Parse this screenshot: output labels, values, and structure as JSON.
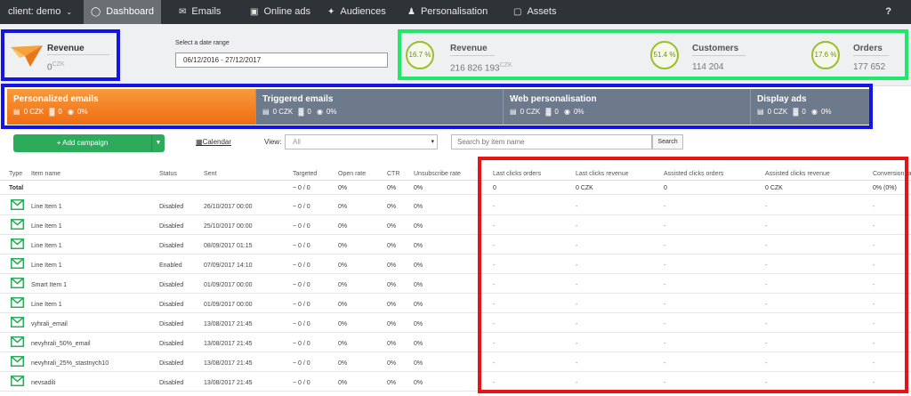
{
  "nav": {
    "client": "client: demo",
    "items": [
      {
        "label": "Dashboard",
        "icon": "dashboard-icon"
      },
      {
        "label": "Emails",
        "icon": "envelope-icon"
      },
      {
        "label": "Online ads",
        "icon": "image-icon"
      },
      {
        "label": "Audiences",
        "icon": "magic-wand-icon"
      },
      {
        "label": "Personalisation",
        "icon": "user-icon"
      },
      {
        "label": "Assets",
        "icon": "monitor-icon"
      }
    ],
    "help": "?"
  },
  "summary": {
    "left": {
      "label": "Revenue",
      "value": "0",
      "currency": "CZK"
    },
    "date_label": "Select a date range",
    "date_value": "06/12/2016 - 27/12/2017",
    "kpis": [
      {
        "percent": "16.7 %",
        "label": "Revenue",
        "value": "216 826 193",
        "currency": "CZK"
      },
      {
        "percent": "51.4 %",
        "label": "Customers",
        "value": "114 204",
        "currency": ""
      },
      {
        "percent": "17.6 %",
        "label": "Orders",
        "value": "177 652",
        "currency": ""
      }
    ]
  },
  "channels": [
    {
      "title": "Personalized emails",
      "revenue": "0 CZK",
      "orders": "0",
      "rate": "0%"
    },
    {
      "title": "Triggered emails",
      "revenue": "0 CZK",
      "orders": "0",
      "rate": "0%"
    },
    {
      "title": "Web personalisation",
      "revenue": "0 CZK",
      "orders": "0",
      "rate": "0%"
    },
    {
      "title": "Display ads",
      "revenue": "0 CZK",
      "orders": "0",
      "rate": "0%"
    }
  ],
  "toolbar": {
    "add_campaign": "+ Add campaign",
    "calendar": "Calendar",
    "view_label": "View:",
    "view_value": "All",
    "search_placeholder": "Search by item name",
    "search_button": "Search"
  },
  "table": {
    "headers": [
      "Type",
      "Item name",
      "Status",
      "Sent",
      "Targeted",
      "Open rate",
      "CTR",
      "Unsubscribe rate",
      "Last clicks orders",
      "Last clicks revenue",
      "Assisted clicks orders",
      "Assisted clicks revenue",
      "Conversion rate"
    ],
    "total": {
      "label": "Total",
      "targeted": "~ 0 / 0",
      "open_rate": "0%",
      "ctr": "0%",
      "unsub": "0%",
      "lc_orders": "0",
      "lc_revenue": "0 CZK",
      "ac_orders": "0",
      "ac_revenue": "0 CZK",
      "conversion": "0% (0%)"
    },
    "rows": [
      {
        "name": "Line Item 1",
        "status": "Disabled",
        "sent": "26/10/2017 00:00",
        "targeted": "~ 0 / 0",
        "open_rate": "0%",
        "ctr": "0%",
        "unsub": "0%"
      },
      {
        "name": "Line Item 1",
        "status": "Disabled",
        "sent": "25/10/2017 00:00",
        "targeted": "~ 0 / 0",
        "open_rate": "0%",
        "ctr": "0%",
        "unsub": "0%"
      },
      {
        "name": "Line Item 1",
        "status": "Disabled",
        "sent": "08/09/2017 01:15",
        "targeted": "~ 0 / 0",
        "open_rate": "0%",
        "ctr": "0%",
        "unsub": "0%"
      },
      {
        "name": "Line Item 1",
        "status": "Enabled",
        "sent": "07/09/2017 14:10",
        "targeted": "~ 0 / 0",
        "open_rate": "0%",
        "ctr": "0%",
        "unsub": "0%"
      },
      {
        "name": "Smart Item 1",
        "status": "Disabled",
        "sent": "01/09/2017 00:00",
        "targeted": "~ 0 / 0",
        "open_rate": "0%",
        "ctr": "0%",
        "unsub": "0%"
      },
      {
        "name": "Line Item 1",
        "status": "Disabled",
        "sent": "01/09/2017 00:00",
        "targeted": "~ 0 / 0",
        "open_rate": "0%",
        "ctr": "0%",
        "unsub": "0%"
      },
      {
        "name": "vyhrali_email",
        "status": "Disabled",
        "sent": "13/08/2017 21:45",
        "targeted": "~ 0 / 0",
        "open_rate": "0%",
        "ctr": "0%",
        "unsub": "0%"
      },
      {
        "name": "nevyhrali_50%_email",
        "status": "Disabled",
        "sent": "13/08/2017 21:45",
        "targeted": "~ 0 / 0",
        "open_rate": "0%",
        "ctr": "0%",
        "unsub": "0%"
      },
      {
        "name": "nevyhrali_25%_stastnych10",
        "status": "Disabled",
        "sent": "13/08/2017 21:45",
        "targeted": "~ 0 / 0",
        "open_rate": "0%",
        "ctr": "0%",
        "unsub": "0%"
      },
      {
        "name": "nevsadili",
        "status": "Disabled",
        "sent": "13/08/2017 21:45",
        "targeted": "~ 0 / 0",
        "open_rate": "0%",
        "ctr": "0%",
        "unsub": "0%"
      }
    ],
    "empty_value": "-"
  },
  "highlight_colors": {
    "blue": "#1414e6",
    "green": "#22e869",
    "red": "#e61414",
    "accent_orange": "#f07a1e",
    "success_green": "#2cab5b"
  }
}
